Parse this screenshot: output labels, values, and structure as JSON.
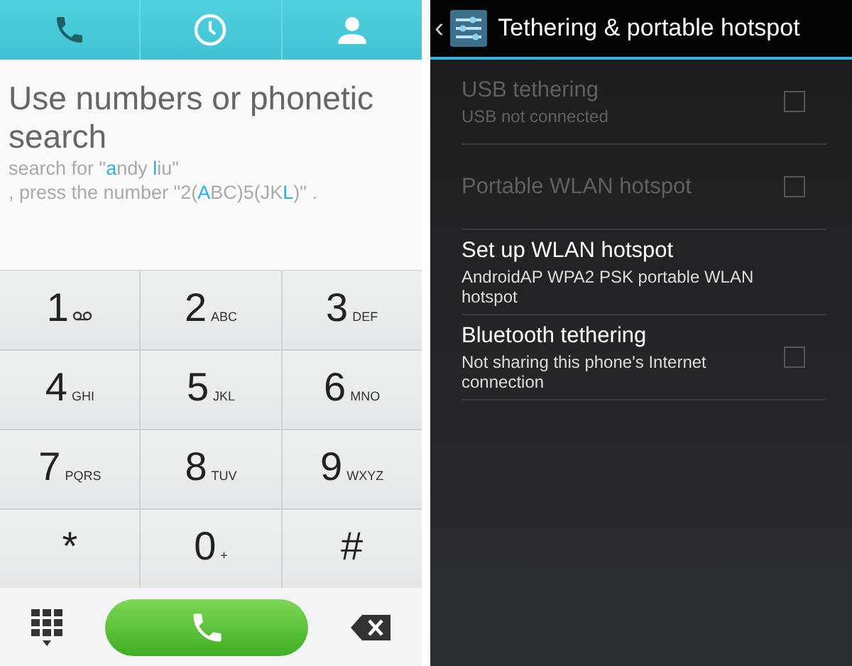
{
  "dialer": {
    "tabs": [
      {
        "kind": "phone",
        "selected": true
      },
      {
        "kind": "clock",
        "selected": false
      },
      {
        "kind": "contact",
        "selected": false
      }
    ],
    "hint": {
      "title": "Use numbers or phonetic search",
      "lines": [
        [
          {
            "text": "search for \"",
            "highlight": false
          },
          {
            "text": "a",
            "highlight": true
          },
          {
            "text": "ndy ",
            "highlight": false
          },
          {
            "text": "l",
            "highlight": true
          },
          {
            "text": "iu\"",
            "highlight": false
          }
        ],
        [
          {
            "text": ", press the number \"2(",
            "highlight": false
          },
          {
            "text": "A",
            "highlight": true
          },
          {
            "text": "BC)5(JK",
            "highlight": false
          },
          {
            "text": "L",
            "highlight": true
          },
          {
            "text": ")\" .",
            "highlight": false
          }
        ]
      ]
    },
    "keys": [
      {
        "digit": "1",
        "kind": "voicemail"
      },
      {
        "digit": "2",
        "letters": "ABC"
      },
      {
        "digit": "3",
        "letters": "DEF"
      },
      {
        "digit": "4",
        "letters": "GHI"
      },
      {
        "digit": "5",
        "letters": "JKL"
      },
      {
        "digit": "6",
        "letters": "MNO"
      },
      {
        "digit": "7",
        "letters": "PQRS"
      },
      {
        "digit": "8",
        "letters": "TUV"
      },
      {
        "digit": "9",
        "letters": "WXYZ"
      },
      {
        "digit": "*"
      },
      {
        "digit": "0",
        "letters": "+"
      },
      {
        "digit": "#"
      }
    ]
  },
  "settings": {
    "title": "Tethering & portable hotspot",
    "back": "‹",
    "items": [
      {
        "title": "USB tethering",
        "summary": "USB not connected",
        "kind": "checkbox",
        "checked": false,
        "disabled": true
      },
      {
        "title": "Portable WLAN hotspot",
        "kind": "checkbox",
        "checked": false,
        "disabled": true
      },
      {
        "title": "Set up WLAN hotspot",
        "summary": "AndroidAP WPA2 PSK portable WLAN hotspot",
        "kind": "plain",
        "disabled": false
      },
      {
        "title": "Bluetooth tethering",
        "summary": "Not sharing this phone's Internet connection",
        "kind": "checkbox",
        "checked": false,
        "disabled": false
      }
    ]
  }
}
